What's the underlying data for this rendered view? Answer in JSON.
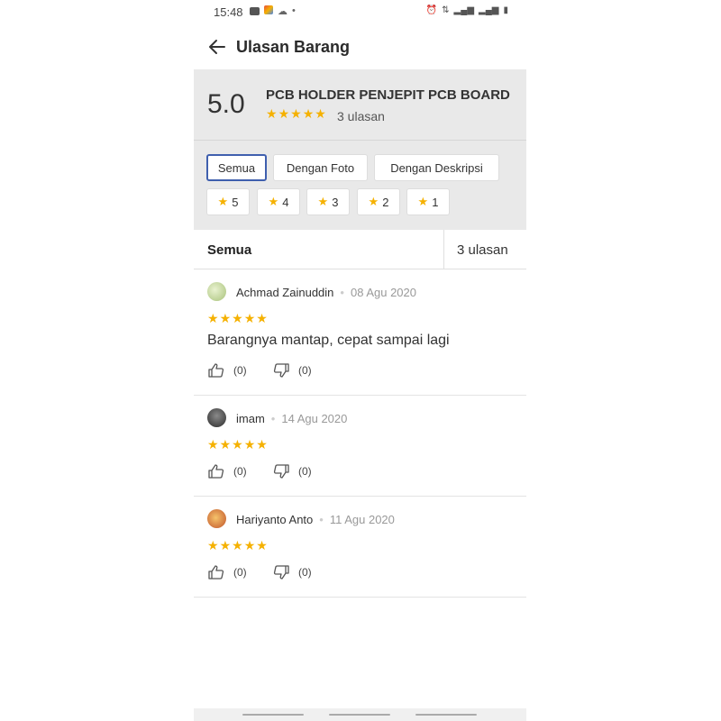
{
  "status": {
    "time": "15:48"
  },
  "header": {
    "title": "Ulasan Barang"
  },
  "summary": {
    "score": "5.0",
    "product_name": "PCB HOLDER PENJEPIT PCB BOARD",
    "stars": 5,
    "count_label": "3 ulasan"
  },
  "filters": {
    "chips": [
      "Semua",
      "Dengan Foto",
      "Dengan Deskripsi"
    ],
    "active": "Semua",
    "ratings": [
      "5",
      "4",
      "3",
      "2",
      "1"
    ]
  },
  "tab": {
    "label": "Semua",
    "count": "3 ulasan"
  },
  "reviews": [
    {
      "name": "Achmad Zainuddin",
      "date": "08 Agu 2020",
      "stars": 5,
      "text": "Barangnya mantap, cepat sampai lagi",
      "likes": "(0)",
      "dislikes": "(0)"
    },
    {
      "name": "imam",
      "date": "14 Agu 2020",
      "stars": 5,
      "text": "",
      "likes": "(0)",
      "dislikes": "(0)"
    },
    {
      "name": "Hariyanto Anto",
      "date": "11 Agu 2020",
      "stars": 5,
      "text": "",
      "likes": "(0)",
      "dislikes": "(0)"
    }
  ],
  "colors": {
    "star": "#f5b100",
    "active_border": "#3f5fae",
    "summary_bg": "#e9e9e9"
  }
}
